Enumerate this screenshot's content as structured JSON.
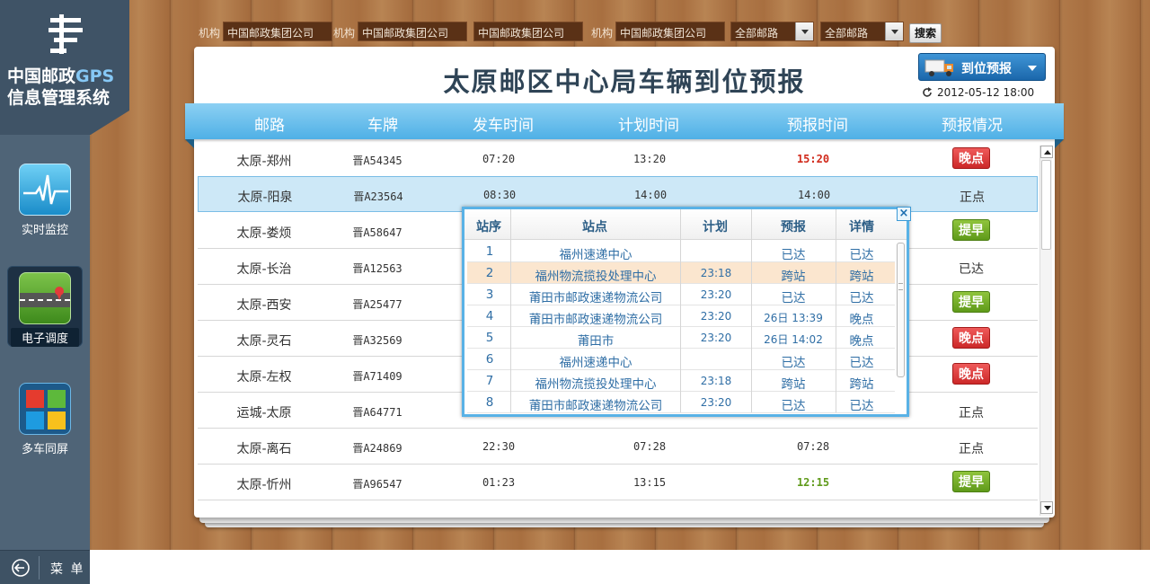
{
  "sidebar": {
    "title_line1_cn": "中国邮政",
    "title_line1_gps": "GPS",
    "title_line2": "信息管理系统",
    "items": [
      {
        "label": "实时监控"
      },
      {
        "label": "电子调度"
      },
      {
        "label": "多车同屏"
      }
    ],
    "menu_label": "菜 单"
  },
  "filters": {
    "org_label": "机构",
    "org_values": [
      "中国邮政集团公司",
      "中国邮政集团公司",
      "中国邮政集团公司",
      "中国邮政集团公司"
    ],
    "route_select_1": "全部邮路",
    "route_select_2": "全部邮路",
    "search_label": "搜索"
  },
  "panel": {
    "title": "太原邮区中心局车辆到位预报",
    "forecast_button": "到位预报",
    "date": "2012-05-12 18:00"
  },
  "table": {
    "columns": [
      "邮路",
      "车牌",
      "发车时间",
      "计划时间",
      "预报时间",
      "预报情况"
    ],
    "rows": [
      {
        "route": "太原-郑州",
        "plate": "晋A54345",
        "depart": "07:20",
        "plan": "13:20",
        "forecast": "15:20",
        "forecast_style": "red",
        "status": "晚点",
        "status_type": "late"
      },
      {
        "route": "太原-阳泉",
        "plate": "晋A23564",
        "depart": "08:30",
        "plan": "14:00",
        "forecast": "14:00",
        "forecast_style": "normal",
        "status": "正点",
        "status_type": "text"
      },
      {
        "route": "太原-娄烦",
        "plate": "晋A58647",
        "depart": "",
        "plan": "",
        "forecast": "",
        "forecast_style": "normal",
        "status": "提早",
        "status_type": "early"
      },
      {
        "route": "太原-长治",
        "plate": "晋A12563",
        "depart": "",
        "plan": "",
        "forecast": "",
        "forecast_style": "normal",
        "status": "已达",
        "status_type": "text"
      },
      {
        "route": "太原-西安",
        "plate": "晋A25477",
        "depart": "",
        "plan": "",
        "forecast": "",
        "forecast_style": "normal",
        "status": "提早",
        "status_type": "early"
      },
      {
        "route": "太原-灵石",
        "plate": "晋A32569",
        "depart": "",
        "plan": "",
        "forecast": "",
        "forecast_style": "normal",
        "status": "晚点",
        "status_type": "late"
      },
      {
        "route": "太原-左权",
        "plate": "晋A71409",
        "depart": "",
        "plan": "",
        "forecast": "",
        "forecast_style": "normal",
        "status": "晚点",
        "status_type": "late"
      },
      {
        "route": "运城-太原",
        "plate": "晋A64771",
        "depart": "",
        "plan": "",
        "forecast": "",
        "forecast_style": "normal",
        "status": "正点",
        "status_type": "text"
      },
      {
        "route": "太原-离石",
        "plate": "晋A24869",
        "depart": "22:30",
        "plan": "07:28",
        "forecast": "07:28",
        "forecast_style": "normal",
        "status": "正点",
        "status_type": "text"
      },
      {
        "route": "太原-忻州",
        "plate": "晋A96547",
        "depart": "01:23",
        "plan": "13:15",
        "forecast": "12:15",
        "forecast_style": "green",
        "status": "提早",
        "status_type": "early"
      }
    ]
  },
  "popup": {
    "columns": [
      "站序",
      "站点",
      "计划",
      "预报",
      "详情"
    ],
    "close_label": "×",
    "rows": [
      {
        "seq": "1",
        "station": "福州速递中心",
        "plan": "",
        "forecast": "已达",
        "detail": "已达"
      },
      {
        "seq": "2",
        "station": "福州物流揽投处理中心",
        "plan": "23:18",
        "forecast": "跨站",
        "detail": "跨站"
      },
      {
        "seq": "3",
        "station": "莆田市邮政速递物流公司",
        "plan": "23:20",
        "forecast": "已达",
        "detail": "已达"
      },
      {
        "seq": "4",
        "station": "莆田市邮政速递物流公司",
        "plan": "23:20",
        "forecast": "26日 13:39",
        "detail": "晚点"
      },
      {
        "seq": "5",
        "station": "莆田市",
        "plan": "23:20",
        "forecast": "26日 14:02",
        "detail": "晚点"
      },
      {
        "seq": "6",
        "station": "福州速递中心",
        "plan": "",
        "forecast": "已达",
        "detail": "已达"
      },
      {
        "seq": "7",
        "station": "福州物流揽投处理中心",
        "plan": "23:18",
        "forecast": "跨站",
        "detail": "跨站"
      },
      {
        "seq": "8",
        "station": "莆田市邮政速递物流公司",
        "plan": "23:20",
        "forecast": "已达",
        "detail": "已达"
      }
    ]
  },
  "colors": {
    "late": "#cc2828",
    "early": "#5f9a1a",
    "header_band": "#4fb0e6",
    "sidebar": "#4f6477"
  }
}
